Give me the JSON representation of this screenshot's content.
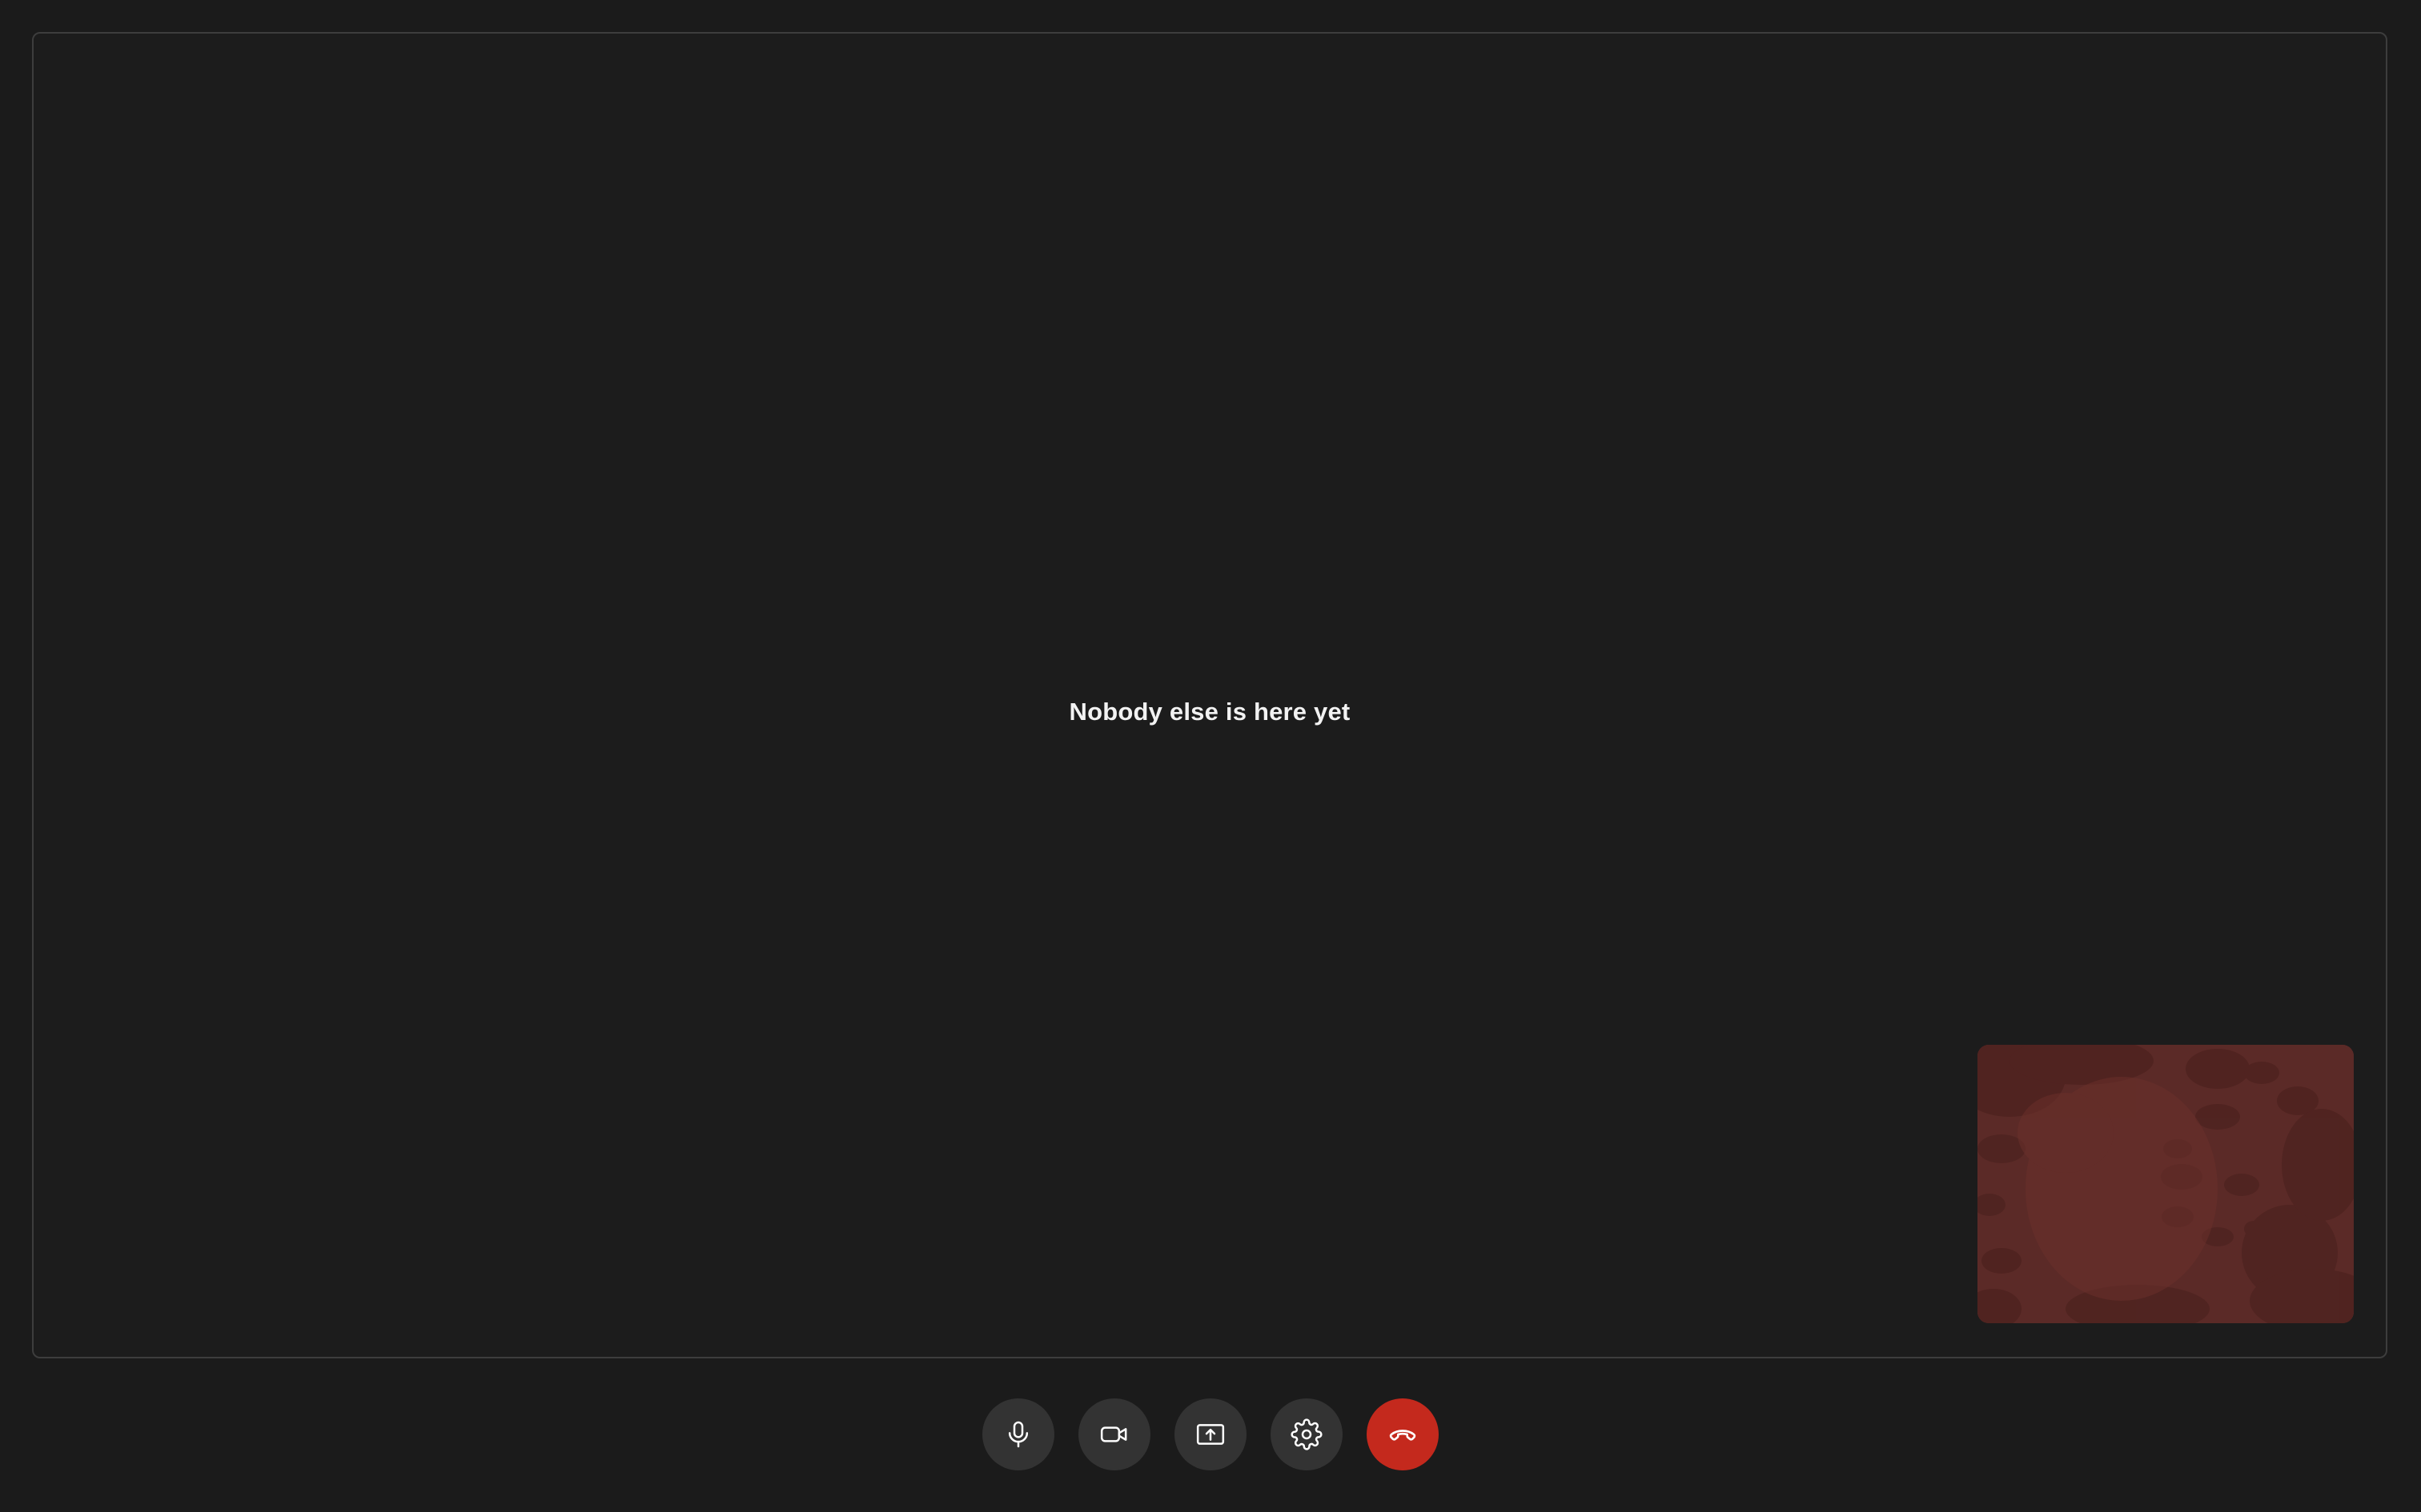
{
  "stage": {
    "empty_message": "Nobody else is here yet"
  },
  "self_view": {
    "tint_color": "#5b2a27"
  },
  "controls": [
    {
      "id": "microphone",
      "icon": "microphone-icon"
    },
    {
      "id": "camera",
      "icon": "video-camera-icon"
    },
    {
      "id": "screen-share",
      "icon": "screen-share-icon"
    },
    {
      "id": "settings",
      "icon": "gear-icon"
    },
    {
      "id": "hang-up",
      "icon": "phone-hangup-icon",
      "color": "#c4291d"
    }
  ]
}
